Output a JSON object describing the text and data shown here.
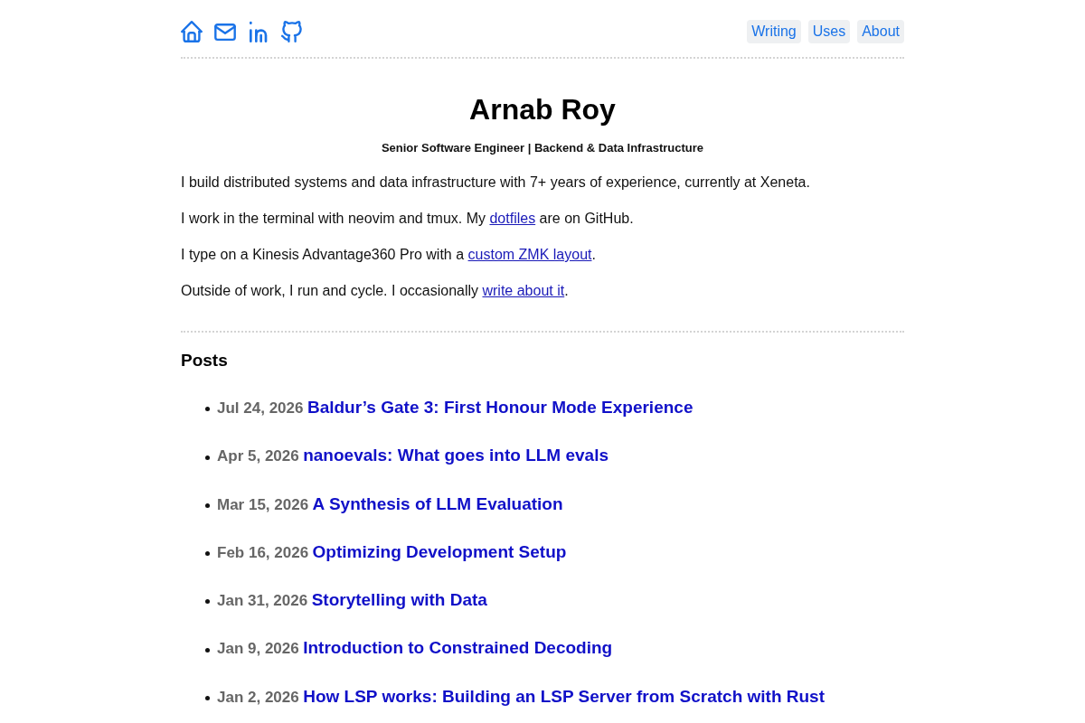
{
  "header": {
    "nav": [
      {
        "label": "Writing"
      },
      {
        "label": "Uses"
      },
      {
        "label": "About"
      }
    ]
  },
  "profile": {
    "name": "Arnab Roy",
    "tagline": "Senior Software Engineer | Backend & Data Infrastructure"
  },
  "intro": [
    {
      "text_before": "I build distributed systems and data infrastructure with 7+ years of experience, currently at Xeneta."
    },
    {
      "text_before": "I work in the terminal with neovim and tmux. My ",
      "link": "dotfiles",
      "text_after": " are on GitHub."
    },
    {
      "text_before": "I type on a Kinesis Advantage360 Pro with a ",
      "link": "custom ZMK layout",
      "text_after": "."
    },
    {
      "text_before": "Outside of work, I run and cycle. I occasionally ",
      "link": "write about it",
      "text_after": "."
    }
  ],
  "posts": {
    "heading": "Posts",
    "items": [
      {
        "date": "Jul 24, 2026",
        "title": "Baldur’s Gate 3: First Honour Mode Experience"
      },
      {
        "date": "Apr 5, 2026",
        "title": "nanoevals: What goes into LLM evals"
      },
      {
        "date": "Mar 15, 2026",
        "title": "A Synthesis of LLM Evaluation"
      },
      {
        "date": "Feb 16, 2026",
        "title": "Optimizing Development Setup"
      },
      {
        "date": "Jan 31, 2026",
        "title": "Storytelling with Data"
      },
      {
        "date": "Jan 9, 2026",
        "title": "Introduction to Constrained Decoding"
      },
      {
        "date": "Jan 2, 2026",
        "title": "How LSP works: Building an LSP Server from Scratch with Rust"
      }
    ]
  }
}
